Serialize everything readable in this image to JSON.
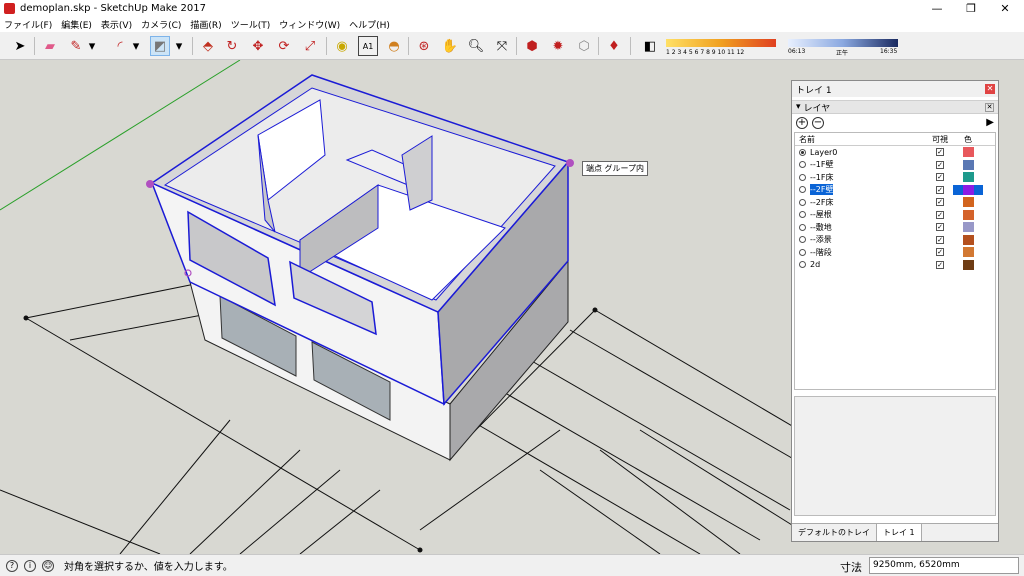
{
  "window": {
    "title": "demoplan.skp - SketchUp Make 2017",
    "minimize": "—",
    "maximize": "❐",
    "close": "✕"
  },
  "menu": [
    "ファイル(F)",
    "編集(E)",
    "表示(V)",
    "カメラ(C)",
    "描画(R)",
    "ツール(T)",
    "ウィンドウ(W)",
    "ヘルプ(H)"
  ],
  "toolbar": {
    "shadow_ticks": "1 2 3 4 5 6 7 8 9 10 11 12",
    "time_start": "06:13",
    "time_noon": "正午",
    "time_end": "16:35"
  },
  "viewport": {
    "tooltip": "端点 グループ内"
  },
  "tray": {
    "title": "トレイ 1",
    "panel_title": "レイヤ",
    "columns": {
      "name": "名前",
      "visible": "可視",
      "color": "色"
    },
    "layers": [
      {
        "name": "Layer0",
        "active": true,
        "visible": true,
        "color": "#e8585c"
      },
      {
        "name": "--1F壁",
        "active": false,
        "visible": true,
        "color": "#5a78b4"
      },
      {
        "name": "--1F床",
        "active": false,
        "visible": true,
        "color": "#1e9a8c"
      },
      {
        "name": "--2F壁",
        "active": false,
        "visible": true,
        "color": "#8c1ce4",
        "selected": true
      },
      {
        "name": "--2F床",
        "active": false,
        "visible": true,
        "color": "#d2641e"
      },
      {
        "name": "--屋根",
        "active": false,
        "visible": true,
        "color": "#d4622a"
      },
      {
        "name": "--敷地",
        "active": false,
        "visible": true,
        "color": "#9898c8"
      },
      {
        "name": "--添景",
        "active": false,
        "visible": true,
        "color": "#b4501e"
      },
      {
        "name": "--階段",
        "active": false,
        "visible": true,
        "color": "#d27832"
      },
      {
        "name": "2d",
        "active": false,
        "visible": true,
        "color": "#6e3c14"
      }
    ],
    "tabs": [
      "デフォルトのトレイ",
      "トレイ 1"
    ]
  },
  "status": {
    "message": "対角を選択するか、値を入力します。",
    "measure_label": "寸法",
    "measure_value": "9250mm, 6520mm"
  },
  "colors": {
    "selection": "#1b1bd6",
    "ground": "#d8d8d2",
    "wall": "#ffffff",
    "wall_shade": "#a9a9ab"
  }
}
